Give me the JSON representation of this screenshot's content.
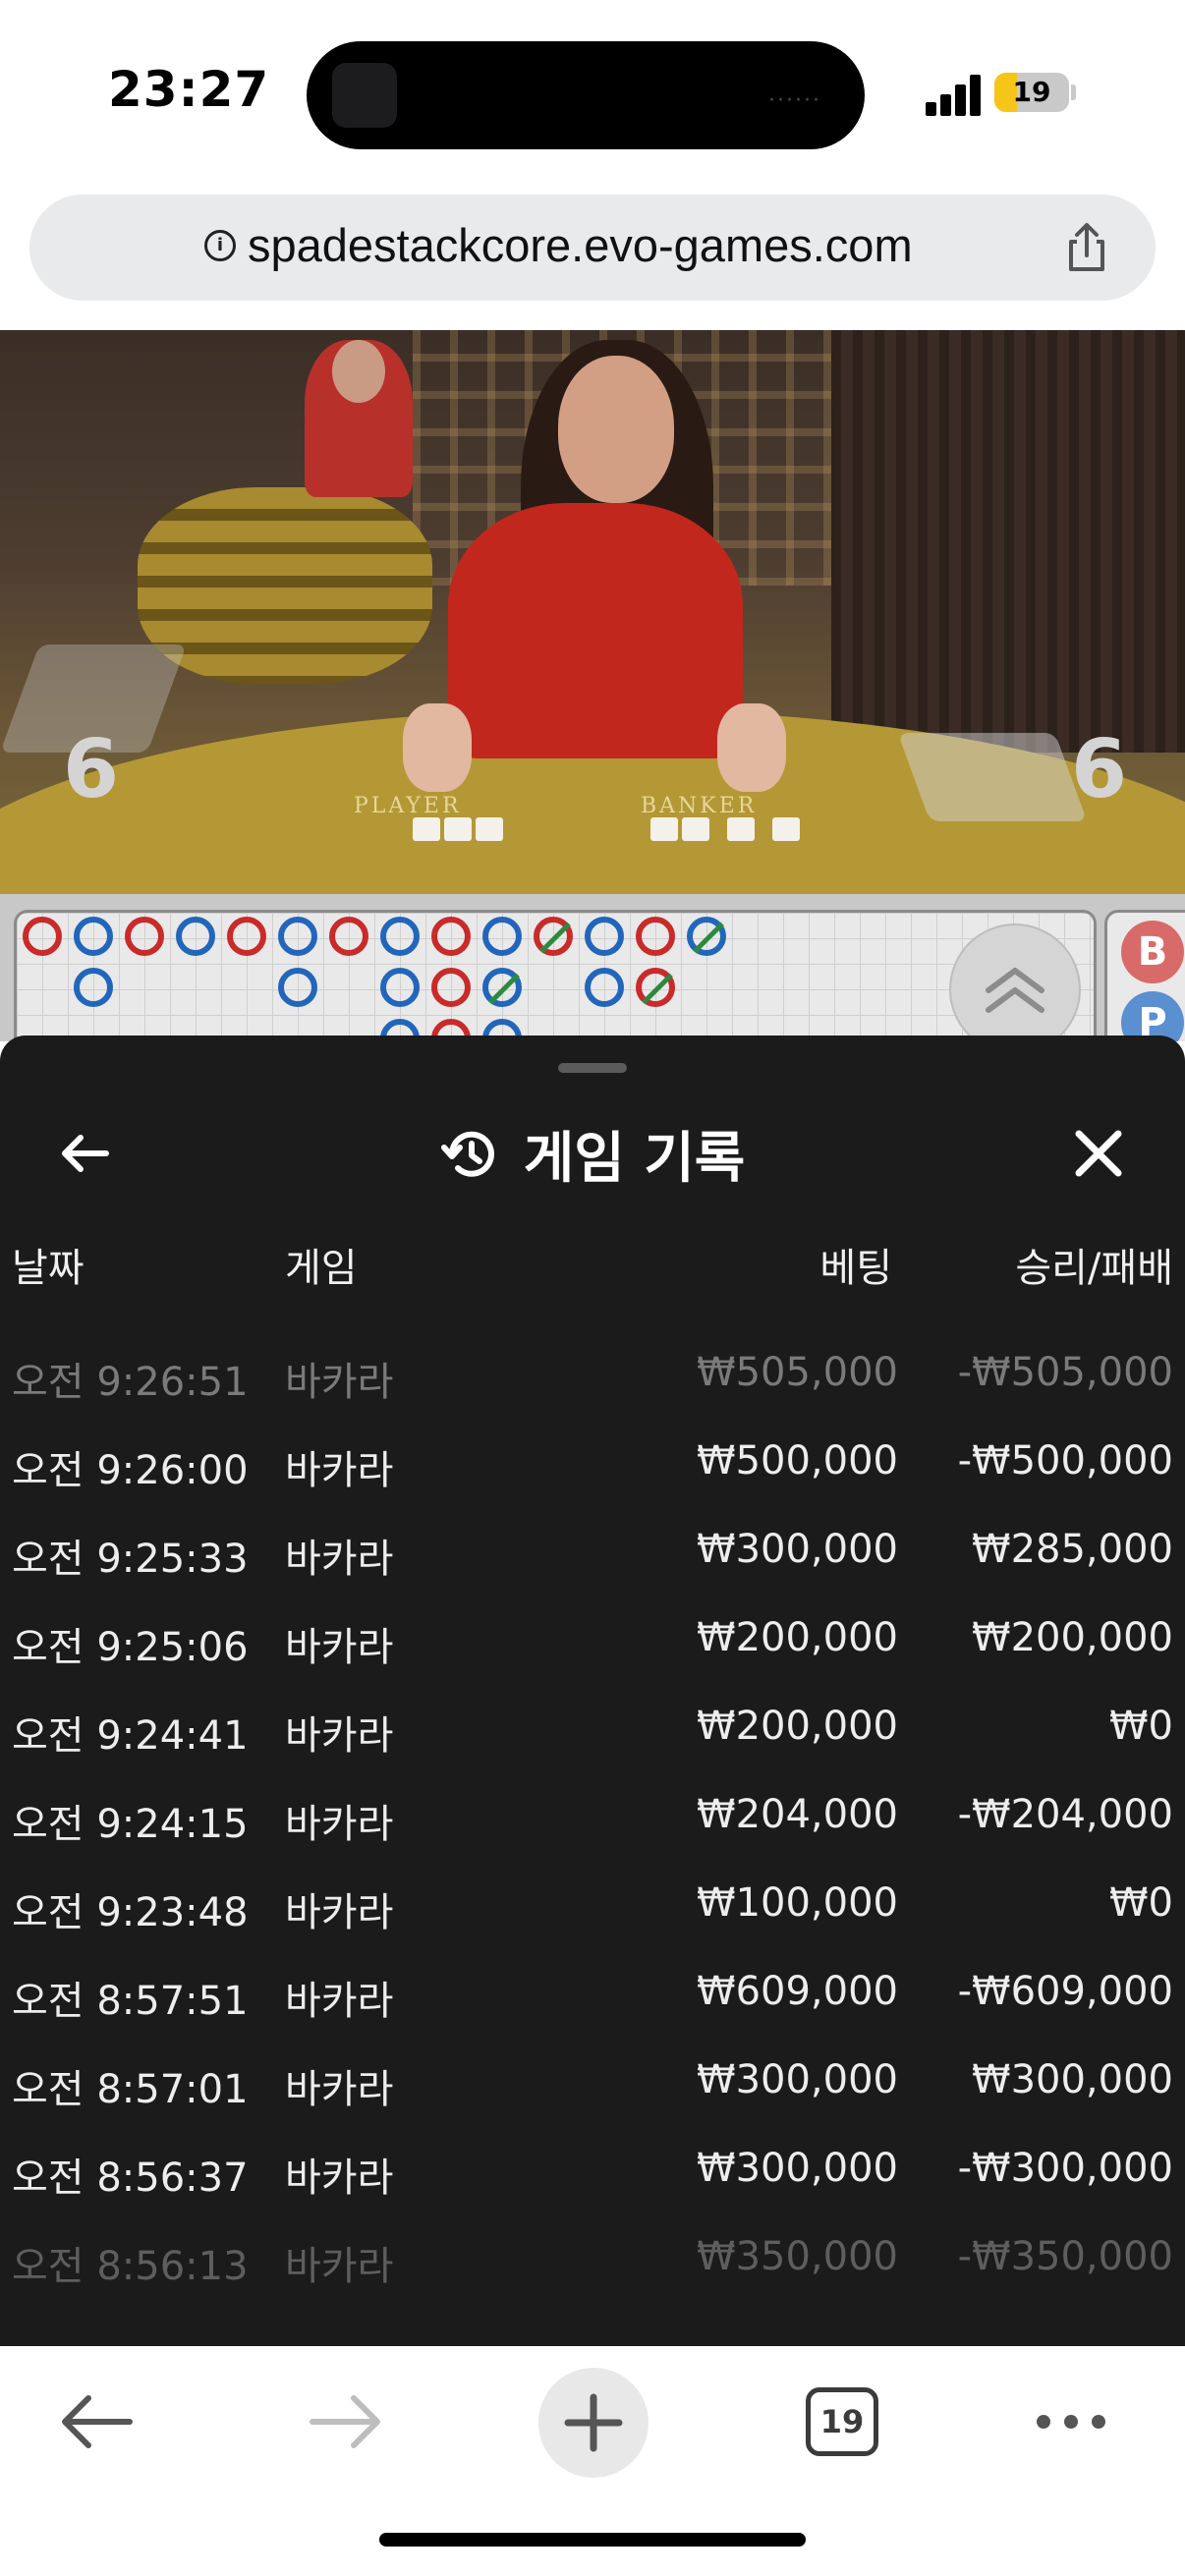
{
  "status": {
    "time": "23:27",
    "battery_level": "19"
  },
  "browser": {
    "url": "spadestackcore.evo-games.com",
    "tab_count": "19"
  },
  "video": {
    "player_label": "PLAYER",
    "banker_label": "BANKER",
    "player_count": "6",
    "banker_count": "6"
  },
  "roadmap": {
    "side_labels": [
      "B",
      "P"
    ]
  },
  "history": {
    "title": "게임 기록",
    "columns": {
      "date": "날짜",
      "game": "게임",
      "bet": "베팅",
      "win_loss": "승리/패배"
    },
    "rows": [
      {
        "date": "오전 9:26:51",
        "game": "바카라",
        "bet": "₩505,000",
        "win_loss": "-₩505,000"
      },
      {
        "date": "오전 9:26:00",
        "game": "바카라",
        "bet": "₩500,000",
        "win_loss": "-₩500,000"
      },
      {
        "date": "오전 9:25:33",
        "game": "바카라",
        "bet": "₩300,000",
        "win_loss": "₩285,000"
      },
      {
        "date": "오전 9:25:06",
        "game": "바카라",
        "bet": "₩200,000",
        "win_loss": "₩200,000"
      },
      {
        "date": "오전 9:24:41",
        "game": "바카라",
        "bet": "₩200,000",
        "win_loss": "₩0"
      },
      {
        "date": "오전 9:24:15",
        "game": "바카라",
        "bet": "₩204,000",
        "win_loss": "-₩204,000"
      },
      {
        "date": "오전 9:23:48",
        "game": "바카라",
        "bet": "₩100,000",
        "win_loss": "₩0"
      },
      {
        "date": "오전 8:57:51",
        "game": "바카라",
        "bet": "₩609,000",
        "win_loss": "-₩609,000"
      },
      {
        "date": "오전 8:57:01",
        "game": "바카라",
        "bet": "₩300,000",
        "win_loss": "₩300,000"
      },
      {
        "date": "오전 8:56:37",
        "game": "바카라",
        "bet": "₩300,000",
        "win_loss": "-₩300,000"
      },
      {
        "date": "오전 8:56:13",
        "game": "바카라",
        "bet": "₩350,000",
        "win_loss": "-₩350,000"
      }
    ]
  },
  "colors": {
    "banker": "#c92a2a",
    "player": "#2266bb",
    "tie": "#2c8a40",
    "sheet_bg": "#1b1b1b"
  },
  "icons": [
    "info-icon",
    "share-icon",
    "history-icon",
    "back-arrow-icon",
    "close-icon",
    "chevron-up-icon",
    "plus-icon",
    "more-icon",
    "forward-arrow-icon"
  ]
}
